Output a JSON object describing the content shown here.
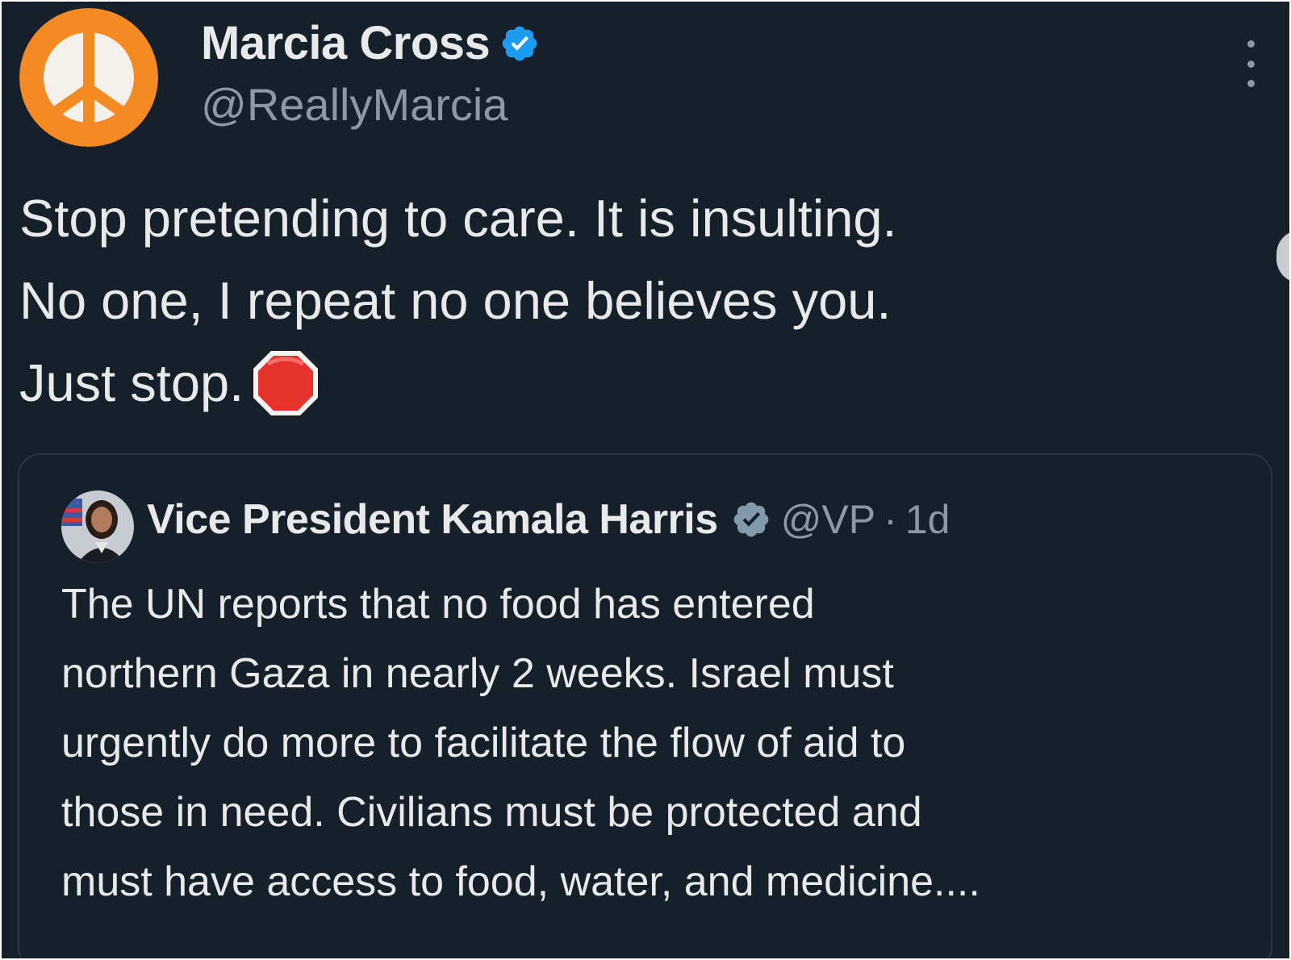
{
  "tweet": {
    "author": {
      "name": "Marcia Cross",
      "handle": "@ReallyMarcia",
      "avatar_icon": "peace-sign-icon",
      "verified": true
    },
    "text_lines": [
      "Stop pretending to care. It is insulting.",
      "No one, I repeat no one believes you.",
      "Just stop."
    ],
    "emoji": "stop-sign-icon"
  },
  "quoted_tweet": {
    "author": {
      "name": "Vice President Kamala Harris",
      "handle": "@VP",
      "verified": true
    },
    "separator": "·",
    "time": "1d",
    "text_lines": [
      "The UN reports that no food has entered",
      "northern Gaza in nearly 2 weeks. Israel must",
      "urgently do more to facilitate the flow of aid to",
      "those in need. Civilians must be protected and",
      "must have access to food, water, and medicine...."
    ]
  },
  "colors": {
    "background": "#15202b",
    "text": "#e7e9ea",
    "secondary_text": "#8b98a5",
    "verified_blue": "#1d9bf0",
    "government_gray": "#829aab",
    "avatar_orange": "#f48a22",
    "stop_red": "#e5322d"
  }
}
